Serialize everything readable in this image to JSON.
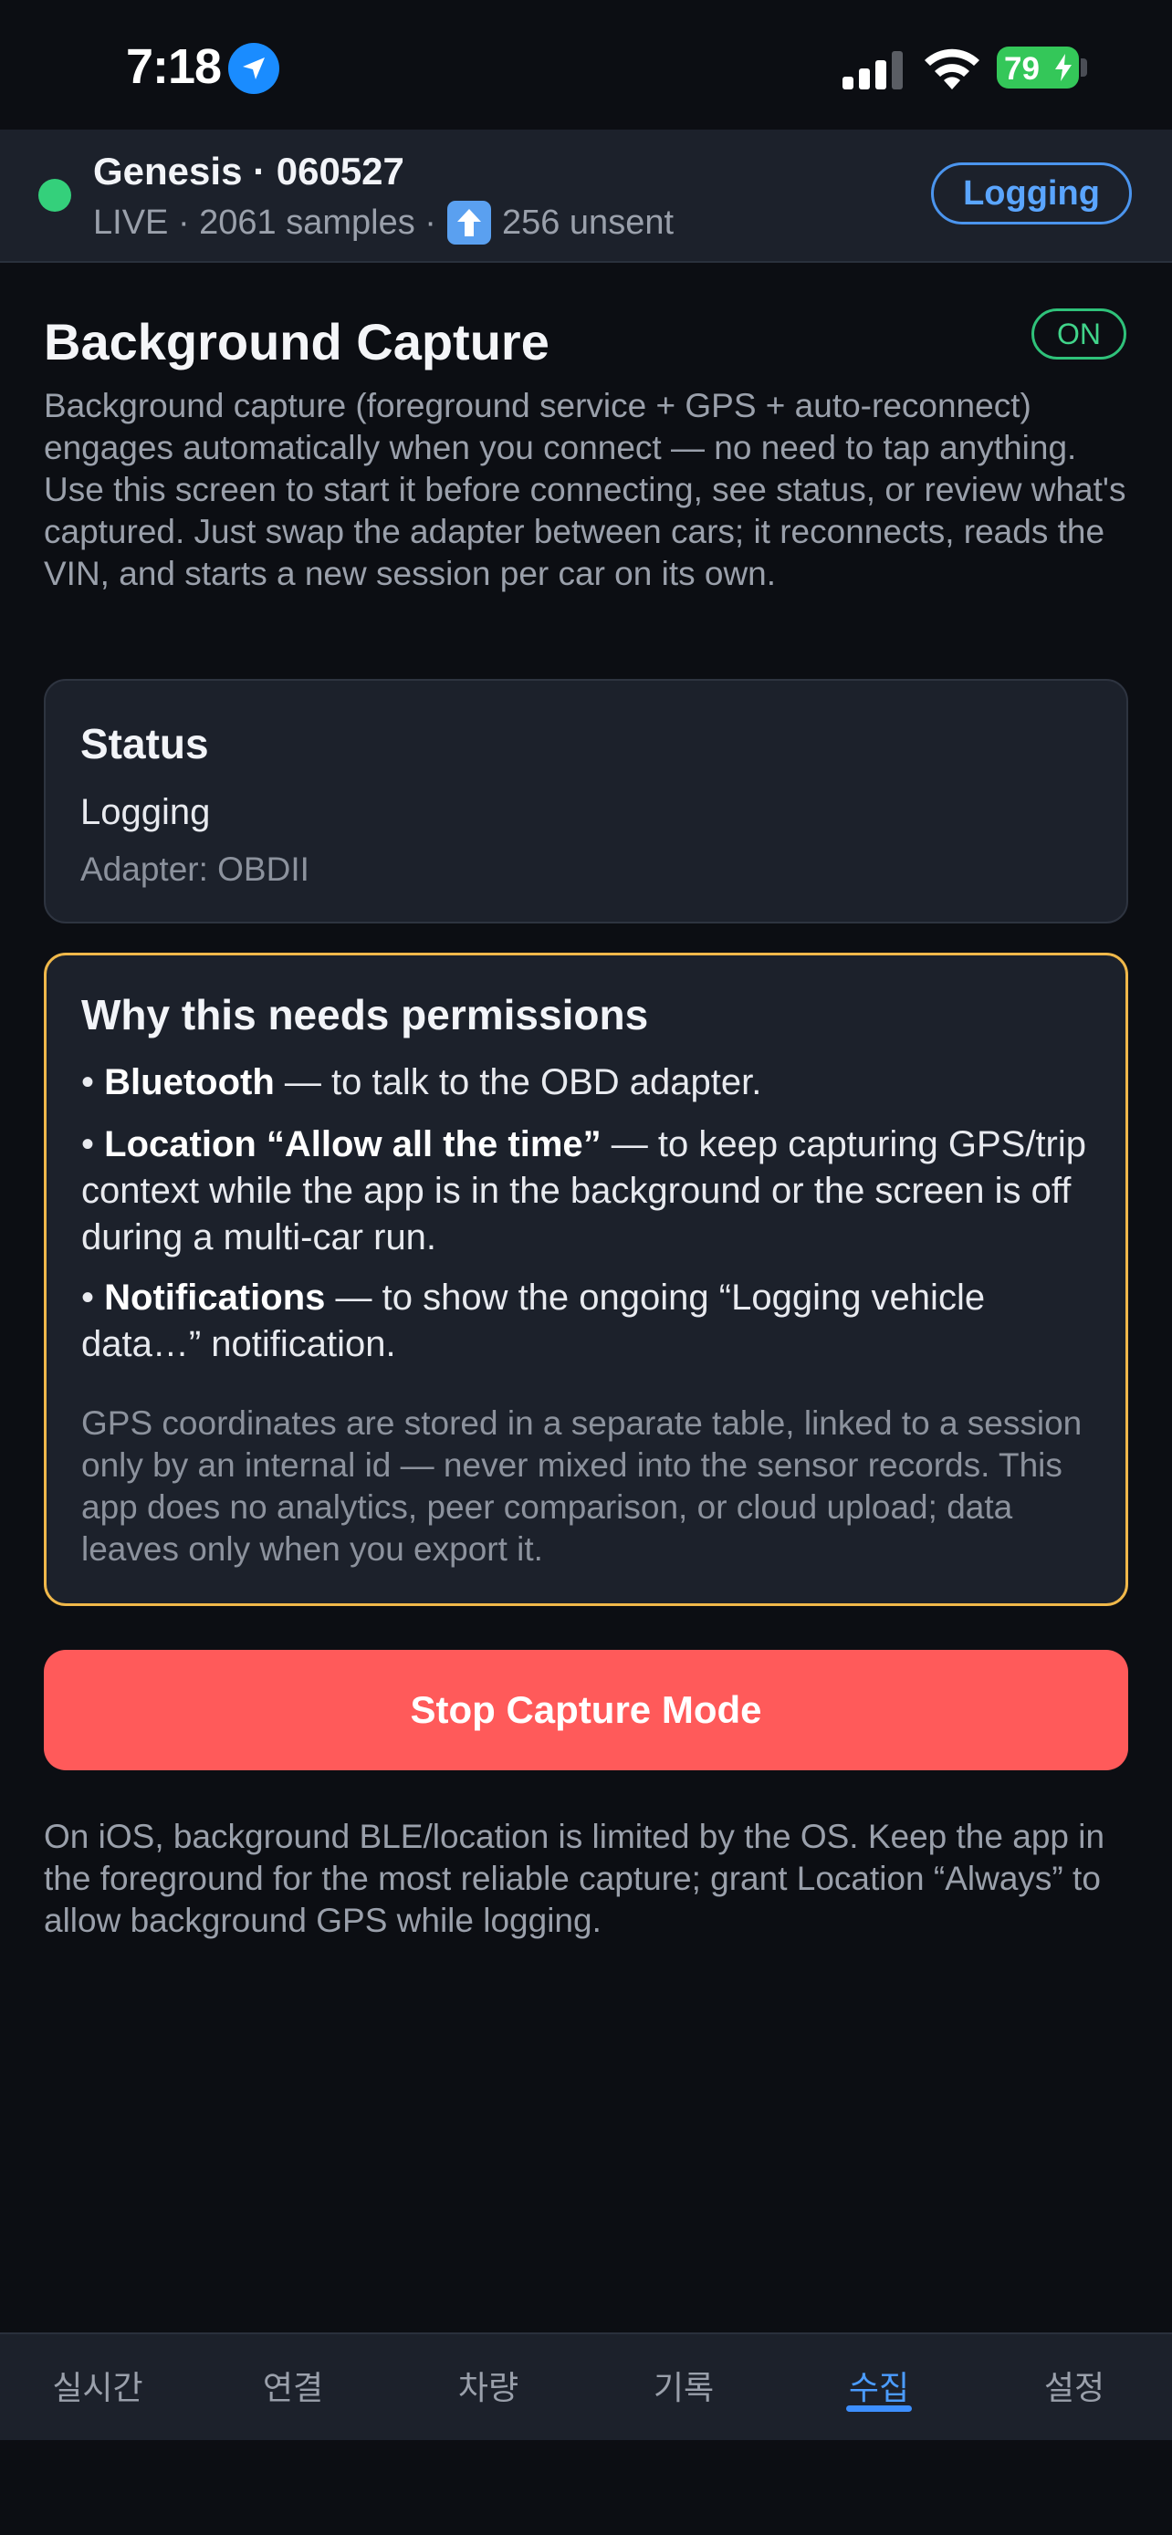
{
  "status_bar": {
    "time": "7:18",
    "battery": "79",
    "icons": [
      "location-arrow-icon",
      "cellular-signal-icon",
      "wifi-icon",
      "battery-charging-icon"
    ]
  },
  "connection": {
    "title": "Genesis · 060527",
    "live_text": "LIVE · 2061 samples ·",
    "unsent_text": "256 unsent",
    "mode_pill": "Logging",
    "status_color": "#34d07b"
  },
  "page": {
    "title": "Background Capture",
    "badge": "ON",
    "intro": "Background capture (foreground service + GPS + auto-reconnect) engages automatically when you connect — no need to tap anything. Use this screen to start it before connecting, see status, or review what's captured. Just swap the adapter between cars; it reconnects, reads the VIN, and starts a new session per car on its own."
  },
  "status_card": {
    "title": "Status",
    "value": "Logging",
    "adapter": "Adapter: OBDII"
  },
  "permissions": {
    "title": "Why this needs permissions",
    "items": [
      {
        "bullet": "•",
        "name": "Bluetooth",
        "desc": " — to talk to the OBD adapter."
      },
      {
        "bullet": "•",
        "name": "Location “Allow all the time”",
        "desc": " — to keep capturing GPS/trip context while the app is in the background or the screen is off during a multi-car run."
      },
      {
        "bullet": "•",
        "name": "Notifications",
        "desc": " — to show the ongoing “Logging vehicle data…” notification."
      }
    ],
    "note": "GPS coordinates are stored in a separate table, linked to a session only by an internal id — never mixed into the sensor records. This app does no analytics, peer comparison, or cloud upload; data leaves only when you export it."
  },
  "actions": {
    "stop_label": "Stop Capture Mode",
    "stop_color": "#ff5a5a"
  },
  "ios_note": "On iOS, background BLE/location is limited by the OS. Keep the app in the foreground for the most reliable capture; grant Location “Always” to allow background GPS while logging.",
  "tabs": [
    {
      "label": "실시간"
    },
    {
      "label": "연결"
    },
    {
      "label": "차량"
    },
    {
      "label": "기록"
    },
    {
      "label": "수집",
      "active": true
    },
    {
      "label": "설정"
    }
  ],
  "colors": {
    "accent": "#4b9cff",
    "warning_border": "#f0b84a",
    "on_green": "#41d48a"
  }
}
